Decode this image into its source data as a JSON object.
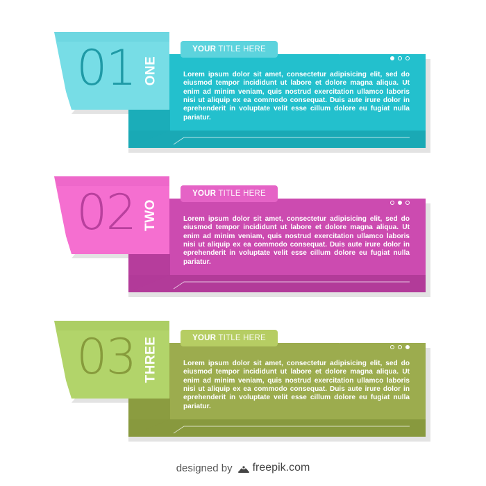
{
  "banners": [
    {
      "number": "01",
      "word": "ONE",
      "title_bold": "YOUR",
      "title_rest": "TITLE HERE",
      "body": "Lorem ipsum dolor sit amet, consectetur adipisicing elit, sed do eiusmod tempor incididunt ut labore et dolore magna aliqua. Ut enim ad minim veniam, quis nostrud exercitation ullamco laboris nisi ut aliquip ex ea commodo consequat. Duis aute irure dolor in eprehenderit in voluptate velit esse cillum dolore eu fugiat nulla pariatur.",
      "colors": {
        "tab": "#77dde6",
        "tab_shade": "#5fcbd6",
        "panel": "#23c0cd",
        "panel_dark": "#1aa9b5",
        "pill": "#5cd3dd",
        "number": "#1f9aa6"
      },
      "active_dot": 0
    },
    {
      "number": "02",
      "word": "TWO",
      "title_bold": "YOUR",
      "title_rest": "TITLE HERE",
      "body": "Lorem ipsum dolor sit amet, consectetur adipisicing elit, sed do eiusmod tempor incididunt ut labore et dolore magna aliqua. Ut enim ad minim veniam, quis nostrud exercitation ullamco laboris nisi ut aliquip ex ea commodo consequat. Duis aute irure dolor in eprehenderit in voluptate velit esse cillum dolore eu fugiat nulla pariatur.",
      "colors": {
        "tab": "#f56fd0",
        "tab_shade": "#e35bbf",
        "panel": "#cc4bb0",
        "panel_dark": "#b23b99",
        "pill": "#e563c6",
        "number": "#b8409d"
      },
      "active_dot": 1
    },
    {
      "number": "03",
      "word": "THREE",
      "title_bold": "YOUR",
      "title_rest": "TITLE HERE",
      "body": "Lorem ipsum dolor sit amet, consectetur adipisicing elit, sed do eiusmod tempor incididunt ut labore et dolore magna aliqua. Ut enim ad minim veniam, quis nostrud exercitation ullamco laboris nisi ut aliquip ex ea commodo consequat. Duis aute irure dolor in eprehenderit in voluptate velit esse cillum dolore eu fugiat nulla pariatur.",
      "colors": {
        "tab": "#b2d46a",
        "tab_shade": "#a0c45a",
        "panel": "#9cac4e",
        "panel_dark": "#88993e",
        "pill": "#b6cd63",
        "number": "#879b3c"
      },
      "active_dot": 2
    }
  ],
  "footer": {
    "prefix": "designed by",
    "brand": "freepik.com",
    "logo_icon": "freepik-logo-icon"
  }
}
